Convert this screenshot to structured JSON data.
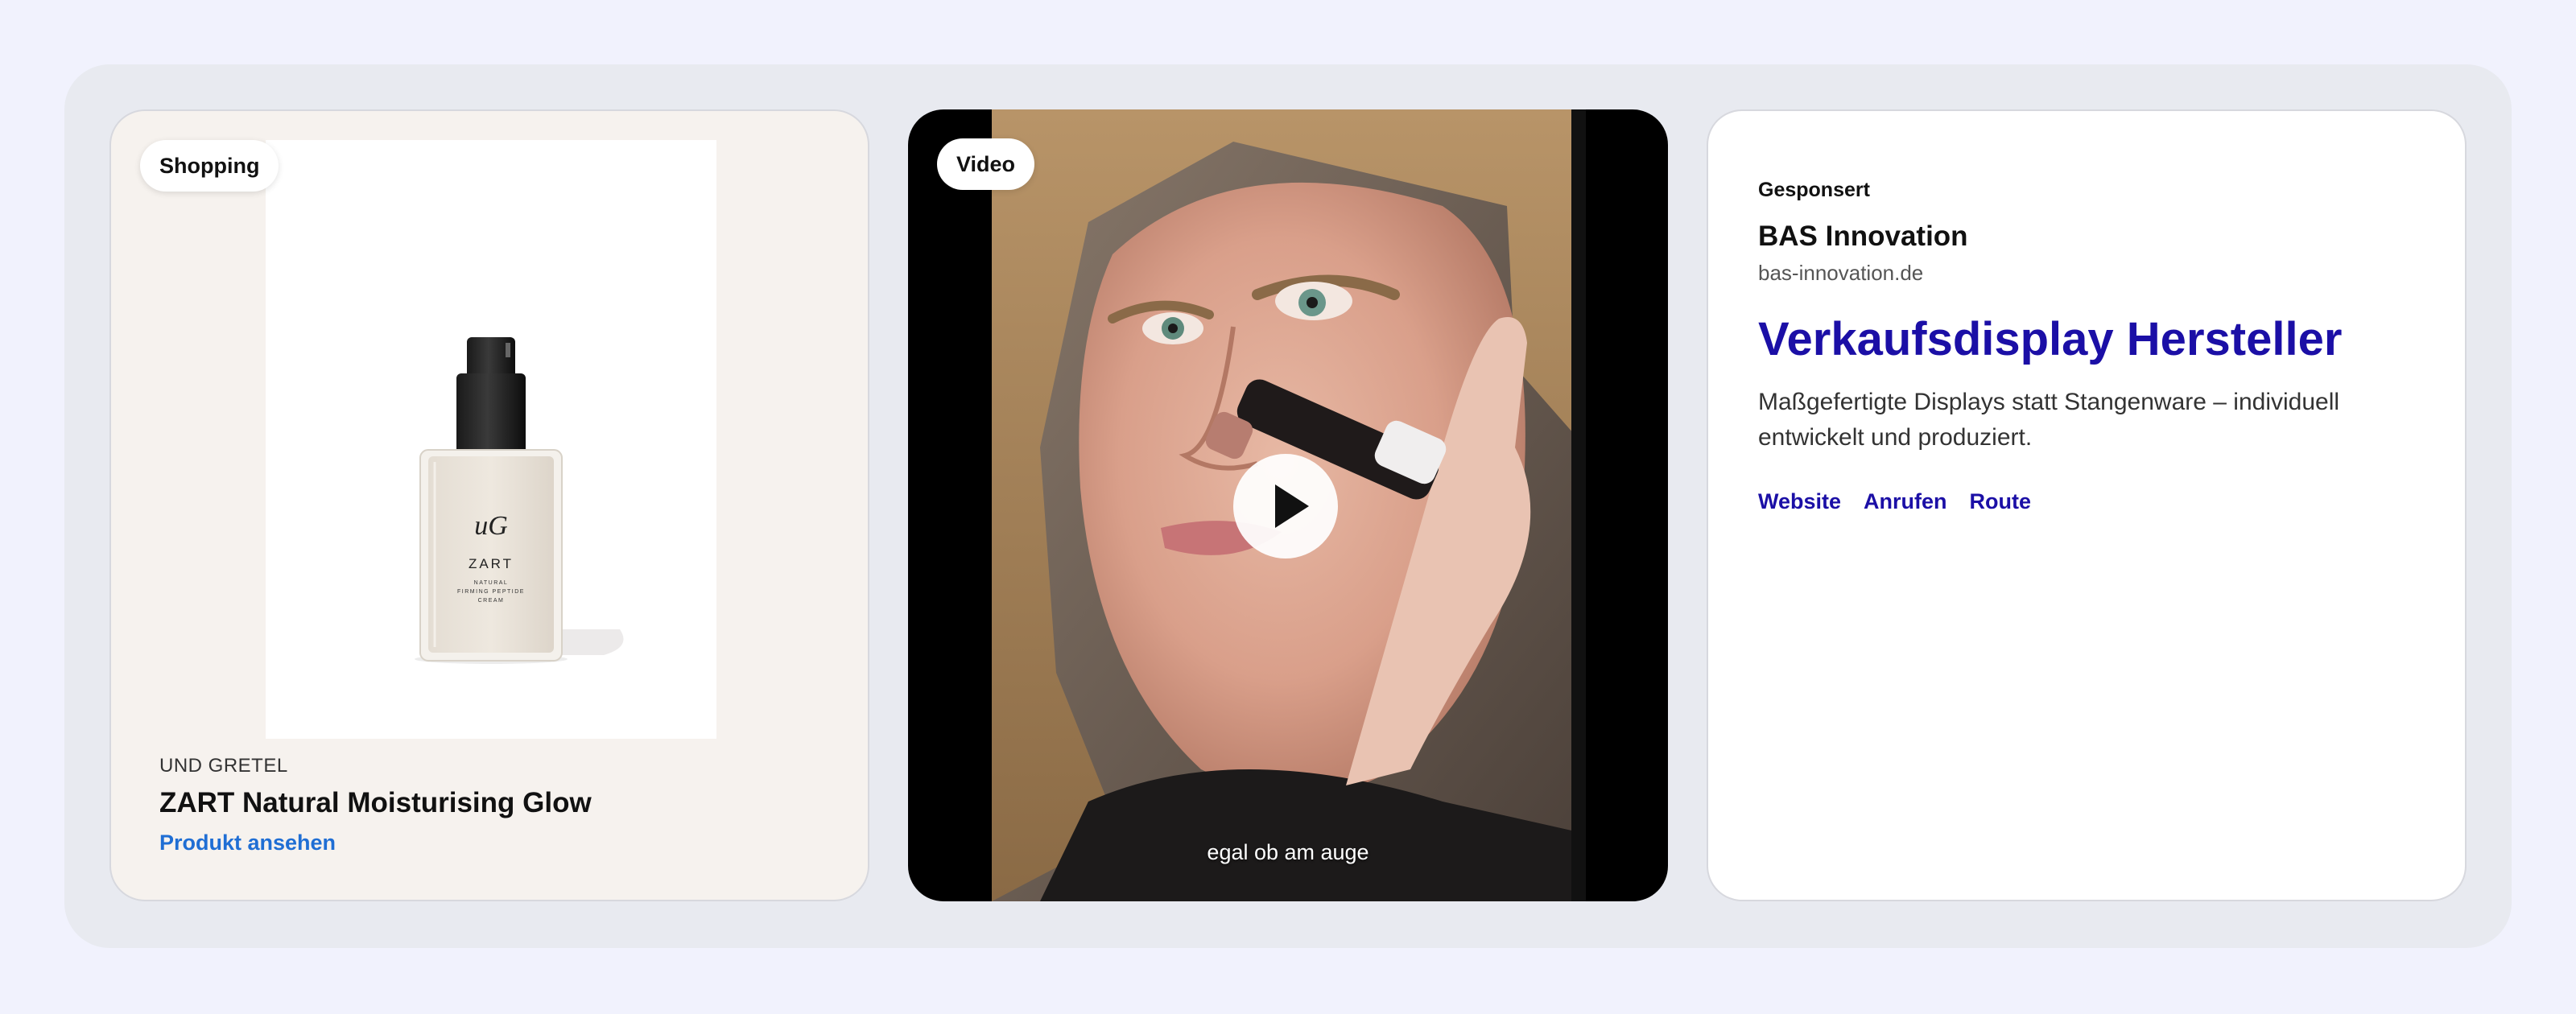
{
  "shopping_card": {
    "badge": "Shopping",
    "brand": "UND GRETEL",
    "title": "ZART Natural Moisturising Glow",
    "link": "Produkt ansehen",
    "product_image": {
      "monogram": "uG",
      "name": "ZART",
      "line1": "NATURAL",
      "line2": "FIRMING PEPTIDE",
      "line3": "CREAM"
    }
  },
  "video_card": {
    "badge": "Video",
    "caption": "egal ob am auge"
  },
  "ad_card": {
    "label": "Gesponsert",
    "advertiser": "BAS Innovation",
    "url": "bas-innovation.de",
    "headline": "Verkaufsdisplay Hersteller",
    "description": "Maßgefertigte Displays statt Stangenware – individuell entwickelt und produziert.",
    "actions": [
      "Website",
      "Anrufen",
      "Route"
    ]
  },
  "colors": {
    "page_background": "#f1f2fd",
    "link_blue": "#1f6ed4",
    "ad_blue": "#1b0fa6"
  },
  "icons": [
    "play-icon"
  ]
}
